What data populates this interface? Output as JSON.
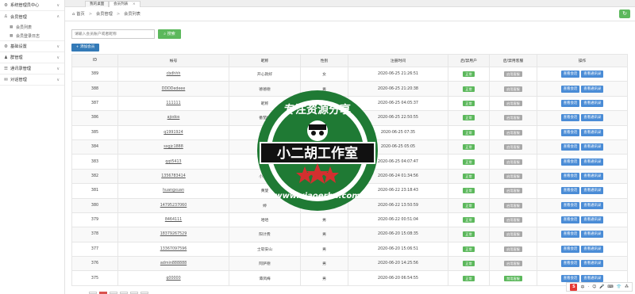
{
  "sidebar": {
    "items": [
      {
        "icon": "gear-icon",
        "glyph": "⚙",
        "label": "系统管理员中心"
      },
      {
        "icon": "user-icon",
        "glyph": "♙",
        "label": "会员管理"
      },
      {
        "icon": "list-icon",
        "glyph": "▦",
        "label": "会员列表"
      },
      {
        "icon": "list-icon",
        "glyph": "▦",
        "label": "会员登录日志"
      },
      {
        "icon": "gear-icon",
        "glyph": "⚙",
        "label": "基础设置"
      },
      {
        "icon": "group-icon",
        "glyph": "♟",
        "label": "群管理"
      },
      {
        "icon": "contacts-icon",
        "glyph": "☰",
        "label": "通讯录管理"
      },
      {
        "icon": "chat-icon",
        "glyph": "✉",
        "label": "对话管理"
      }
    ]
  },
  "tabs": {
    "desk": "我的桌面",
    "member_list": "会员列表",
    "close": "×"
  },
  "breadcrumb": {
    "home": "首页",
    "level1": "会员管理",
    "level2": "会员列表",
    "separator": ">"
  },
  "search": {
    "placeholder": "请输入会员账户或者昵称",
    "button": "搜索",
    "add_button": "+ 添加会员"
  },
  "table": {
    "headers": [
      "ID",
      "帐号",
      "昵称",
      "性别",
      "注册时间",
      "启/禁用户",
      "启/禁用客服",
      "操作"
    ],
    "op_view_chat": "查看会话",
    "op_view_contacts": "查看通讯录",
    "rows": [
      {
        "id": "389",
        "account": "cbdhhh",
        "nick": "开心就好",
        "sex": "女",
        "time": "2020-06-25 21:26:51",
        "user": "正常",
        "cs": "启用客服"
      },
      {
        "id": "388",
        "account": "DDDDedeee",
        "nick": "德德德",
        "sex": "男",
        "time": "2020-06-25 21:20:38",
        "user": "正常",
        "cs": "启用客服"
      },
      {
        "id": "387",
        "account": "111111",
        "nick": "昵称",
        "sex": "",
        "time": "2020-06-25 04:05:37",
        "user": "正常",
        "cs": "启用客服"
      },
      {
        "id": "386",
        "account": "ajodos",
        "nick": "番茄树",
        "sex": "",
        "time": "2020-06-25 22:50:55",
        "user": "正常",
        "cs": "启用客服"
      },
      {
        "id": "385",
        "account": "q1991924",
        "nick": "张四",
        "sex": "",
        "time": "2020-06-25 07:35",
        "user": "正常",
        "cs": "启用客服"
      },
      {
        "id": "384",
        "account": "sxgjc1888",
        "nick": "你好",
        "sex": "",
        "time": "2020-06-25 05:05",
        "user": "正常",
        "cs": "启用客服"
      },
      {
        "id": "383",
        "account": "qqt5413",
        "nick": "张",
        "sex": "",
        "time": "2020-06-25 04:07:47",
        "user": "正常",
        "cs": "启用客服"
      },
      {
        "id": "382",
        "account": "1356783414",
        "nick": "小婉娘",
        "sex": "",
        "time": "2020-06-24 01:34:56",
        "user": "正常",
        "cs": "启用客服"
      },
      {
        "id": "381",
        "account": "huangxuan",
        "nick": "黄旋",
        "sex": "",
        "time": "2020-06-22 23:18:43",
        "user": "正常",
        "cs": "启用客服"
      },
      {
        "id": "380",
        "account": "14795237060",
        "nick": "婷",
        "sex": "女",
        "time": "2020-06-22 13:50:59",
        "user": "正常",
        "cs": "启用客服"
      },
      {
        "id": "379",
        "account": "8464111",
        "nick": "哈哈",
        "sex": "男",
        "time": "2020-06-22 00:51:04",
        "user": "正常",
        "cs": "启用客服"
      },
      {
        "id": "378",
        "account": "18379267529",
        "nick": "阳计费",
        "sex": "男",
        "time": "2020-06-20 15:08:35",
        "user": "正常",
        "cs": "启用客服"
      },
      {
        "id": "377",
        "account": "13367097596",
        "nick": "士软安山",
        "sex": "男",
        "time": "2020-06-20 15:06:51",
        "user": "正常",
        "cs": "启用客服"
      },
      {
        "id": "376",
        "account": "admin888888",
        "nick": "阿萨德",
        "sex": "男",
        "time": "2020-06-20 14:25:56",
        "user": "正常",
        "cs": "启用客服"
      },
      {
        "id": "375",
        "account": "q00000",
        "nick": "谭凤梅",
        "sex": "男",
        "time": "2020-06-20 06:54:55",
        "user": "正常",
        "cs": "禁用客服"
      }
    ]
  },
  "watermark": {
    "top_text": "专注资源分享",
    "banner": "小二胡工作室",
    "url": "www.xiaoerhu.com",
    "colors": {
      "green": "#1f7a34",
      "red": "#d32f2f",
      "black": "#111111"
    }
  },
  "tray": {
    "s_logo": "S",
    "lang": "中",
    "items": [
      "·",
      "☺",
      "🎤",
      "⌨",
      "👕",
      "⁂"
    ]
  },
  "colors": {
    "primary": "#337ab7",
    "success": "#5cb85c",
    "op_button": "#4a8cd6",
    "disabled": "#a8a8a8"
  }
}
